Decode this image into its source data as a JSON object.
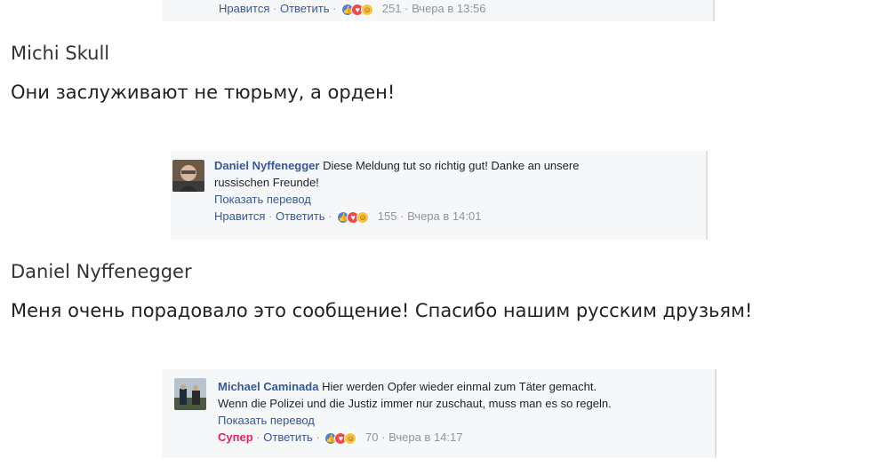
{
  "top_card": {
    "like": "Нравится",
    "reply": "Ответить",
    "count": "251",
    "time": "Вчера в 13:56",
    "sep": "·"
  },
  "block1": {
    "name": "Michi Skull",
    "translation": "Они заслуживают не тюрьму, а орден!"
  },
  "card1": {
    "author": "Daniel Nyffenegger",
    "text_line1": "Diese Meldung tut so richtig gut! Danke an unsere",
    "text_line2": "russischen Freunde!",
    "translate": "Показать перевод",
    "like": "Нравится",
    "reply": "Ответить",
    "count": "155",
    "time": "Вчера в 14:01",
    "sep": "·"
  },
  "block2": {
    "name": "Daniel Nyffenegger",
    "translation": "Меня очень порадовало это сообщение! Спасибо нашим русским друзьям!"
  },
  "card2": {
    "author": "Michael Caminada",
    "text_line1": "Hier werden Opfer wieder einmal zum Täter gemacht.",
    "text_line2": "Wenn die Polizei und die Justiz immer nur zuschaut, muss man es so regeln.",
    "translate": "Показать перевод",
    "like": "Супер",
    "reply": "Ответить",
    "count": "70",
    "time": "Вчера в 14:17",
    "sep": "·"
  },
  "icons": {
    "like": "thumbs-up-icon",
    "love": "heart-icon",
    "haha": "laughing-face-icon"
  },
  "colors": {
    "link": "#365899",
    "muted": "#90949c",
    "super": "#e0245e",
    "card_bg": "#f6f7f9"
  }
}
